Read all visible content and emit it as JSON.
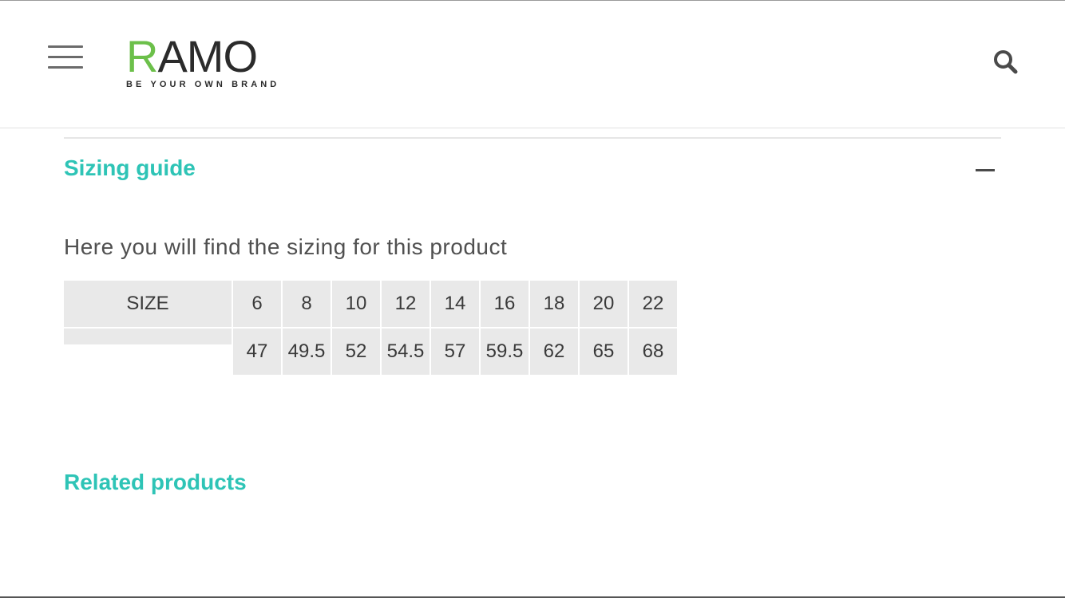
{
  "header": {
    "logo": {
      "word_first": "R",
      "word_rest": "AMO",
      "tagline": "BE YOUR OWN BRAND"
    },
    "menu_icon": "hamburger-menu-icon",
    "search_icon": "search-icon"
  },
  "sizing_guide": {
    "title": "Sizing guide",
    "intro": "Here you will find the sizing for this product",
    "table": {
      "header_label": "SIZE",
      "sizes": [
        "6",
        "8",
        "10",
        "12",
        "14",
        "16",
        "18",
        "20",
        "22"
      ],
      "row_label": "",
      "measurements": [
        "47",
        "49.5",
        "52",
        "54.5",
        "57",
        "59.5",
        "62",
        "65",
        "68"
      ]
    }
  },
  "related_products": {
    "title": "Related products"
  },
  "colors": {
    "accent": "#2ec4b6",
    "logo_green": "#6cc04a",
    "cell_bg": "#e9e9e9"
  }
}
